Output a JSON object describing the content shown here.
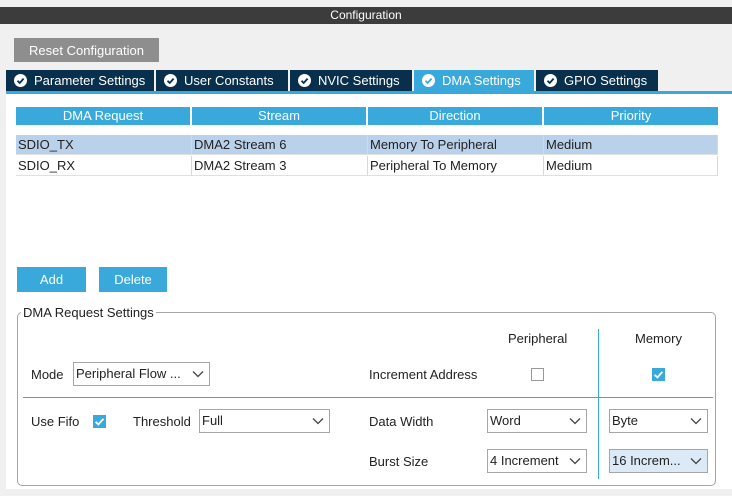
{
  "window": {
    "title": "Configuration"
  },
  "toolbar": {
    "reset_label": "Reset Configuration"
  },
  "tabs": [
    {
      "label": "Parameter Settings",
      "active": false
    },
    {
      "label": "User Constants",
      "active": false
    },
    {
      "label": "NVIC Settings",
      "active": false
    },
    {
      "label": "DMA Settings",
      "active": true
    },
    {
      "label": "GPIO Settings",
      "active": false
    }
  ],
  "table": {
    "headers": [
      "DMA Request",
      "Stream",
      "Direction",
      "Priority"
    ],
    "rows": [
      {
        "cells": [
          "SDIO_TX",
          "DMA2 Stream 6",
          "Memory To Peripheral",
          "Medium"
        ],
        "selected": true
      },
      {
        "cells": [
          "SDIO_RX",
          "DMA2 Stream 3",
          "Peripheral To Memory",
          "Medium"
        ],
        "selected": false
      }
    ]
  },
  "actions": {
    "add_label": "Add",
    "delete_label": "Delete"
  },
  "dma_settings": {
    "legend": "DMA Request Settings",
    "col_peripheral": "Peripheral",
    "col_memory": "Memory",
    "mode_label": "Mode",
    "mode_value": "Peripheral Flow ...",
    "increment_label": "Increment Address",
    "peripheral_increment": false,
    "memory_increment": true,
    "use_fifo_label": "Use Fifo",
    "use_fifo": true,
    "threshold_label": "Threshold",
    "threshold_value": "Full",
    "data_width_label": "Data Width",
    "peripheral_data_width": "Word",
    "memory_data_width": "Byte",
    "burst_size_label": "Burst Size",
    "peripheral_burst": "4 Increment",
    "memory_burst": "16 Increm..."
  },
  "colors": {
    "accent": "#39a9dc",
    "tab_dark": "#08304d",
    "title_bar": "#3c3c3c",
    "selection": "#b9d1ea"
  }
}
